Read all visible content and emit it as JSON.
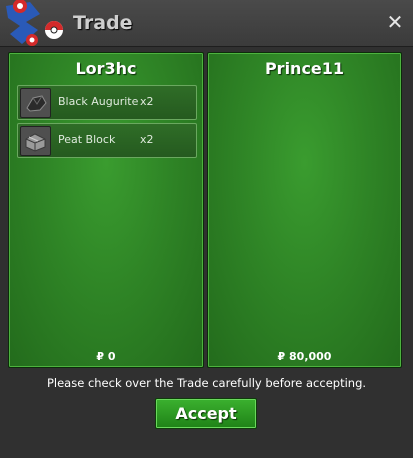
{
  "window": {
    "title": "Trade",
    "close_symbol": "✕"
  },
  "left_panel": {
    "player_name": "Lor3hc",
    "items": [
      {
        "name": "Black Augurite",
        "quantity": "x2",
        "icon": "augurite-ore-icon"
      },
      {
        "name": "Peat Block",
        "quantity": "x2",
        "icon": "peat-block-icon"
      }
    ],
    "money": "₽ 0"
  },
  "right_panel": {
    "player_name": "Prince11",
    "items": [],
    "money": "₽ 80,000"
  },
  "notice": "Please check over the Trade carefully before accepting.",
  "accept_label": "Accept",
  "colors": {
    "panel_green": "#2f8526",
    "accept_green": "#2a9a22",
    "titlebar": "#3f3f3f"
  }
}
